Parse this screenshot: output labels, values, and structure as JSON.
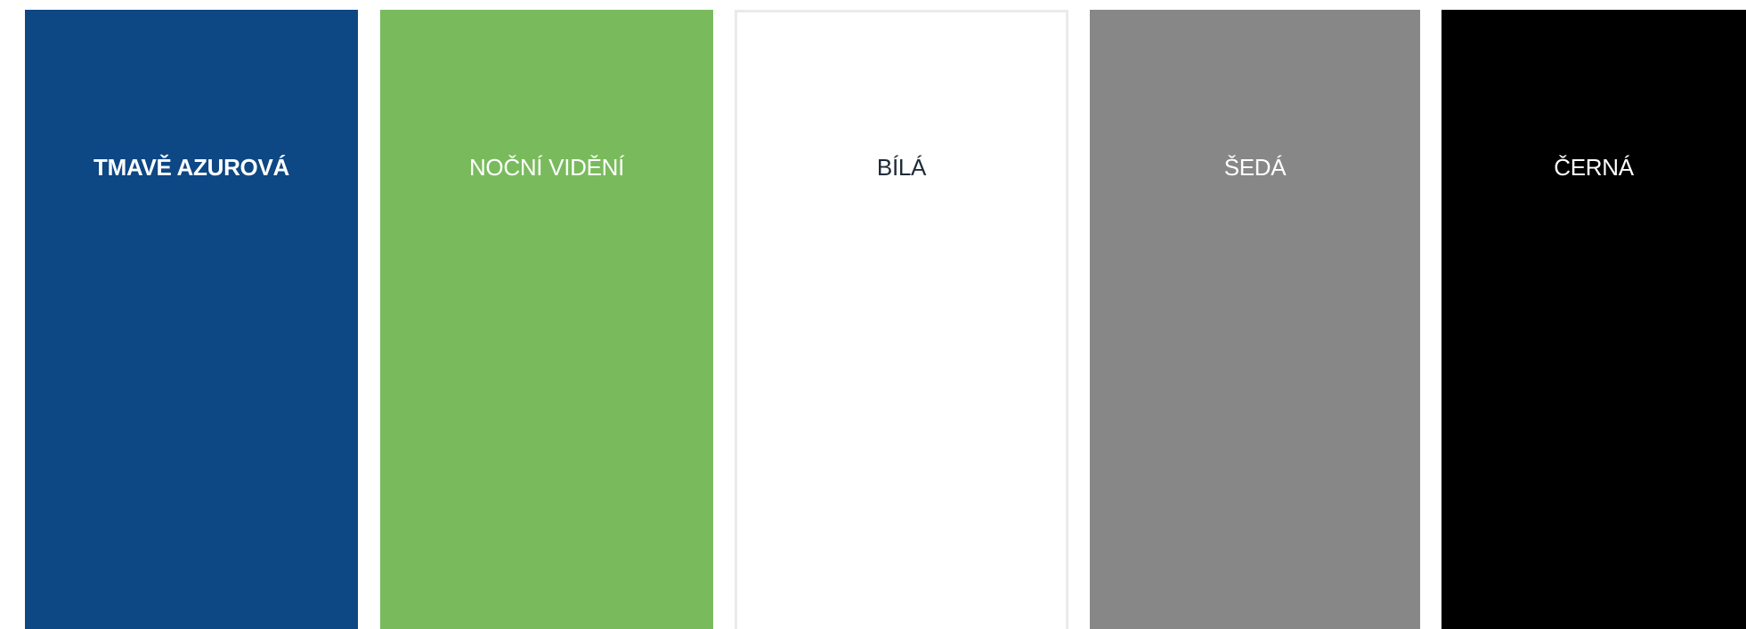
{
  "swatches": [
    {
      "label": "TMAVĚ AZUROVÁ",
      "background": "#0d4784",
      "text_color": "#ffffff"
    },
    {
      "label": "NOČNÍ VIDĚNÍ",
      "background": "#79bb5c",
      "text_color": "#ffffff"
    },
    {
      "label": "BÍLÁ",
      "background": "#ffffff",
      "text_color": "#1e2a3a"
    },
    {
      "label": "ŠEDÁ",
      "background": "#878787",
      "text_color": "#ffffff"
    },
    {
      "label": "ČERNÁ",
      "background": "#000000",
      "text_color": "#ffffff"
    }
  ]
}
